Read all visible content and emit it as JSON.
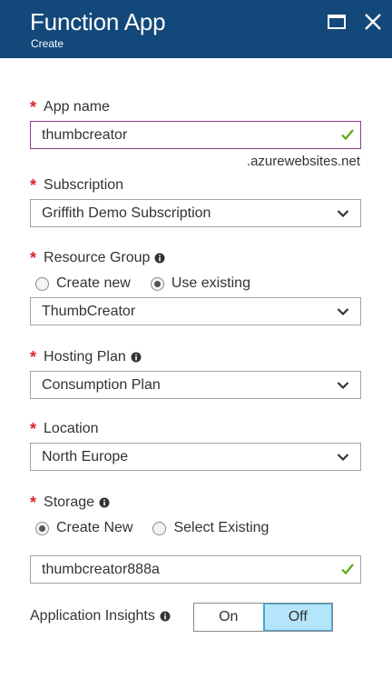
{
  "header": {
    "title": "Function App",
    "subtitle": "Create",
    "background": "#12487a"
  },
  "app_name": {
    "label": "App name",
    "value": "thumbcreator",
    "suffix": ".azurewebsites.net",
    "valid": true
  },
  "subscription": {
    "label": "Subscription",
    "value": "Griffith Demo Subscription"
  },
  "resource_group": {
    "label": "Resource Group",
    "options": [
      "Create new",
      "Use existing"
    ],
    "selected": "Use existing",
    "value": "ThumbCreator"
  },
  "hosting_plan": {
    "label": "Hosting Plan",
    "value": "Consumption Plan"
  },
  "location": {
    "label": "Location",
    "value": "North Europe"
  },
  "storage": {
    "label": "Storage",
    "options": [
      "Create New",
      "Select Existing"
    ],
    "selected": "Create New",
    "value": "thumbcreator888a",
    "valid": true
  },
  "app_insights": {
    "label": "Application Insights",
    "on_label": "On",
    "off_label": "Off",
    "selected": "Off"
  },
  "required_marker": "*",
  "colors": {
    "required": "#d9262a",
    "valid_check": "#5ba80f",
    "toggle_selected": "#b5e5fa",
    "focus_border": "#8c3d8c"
  }
}
